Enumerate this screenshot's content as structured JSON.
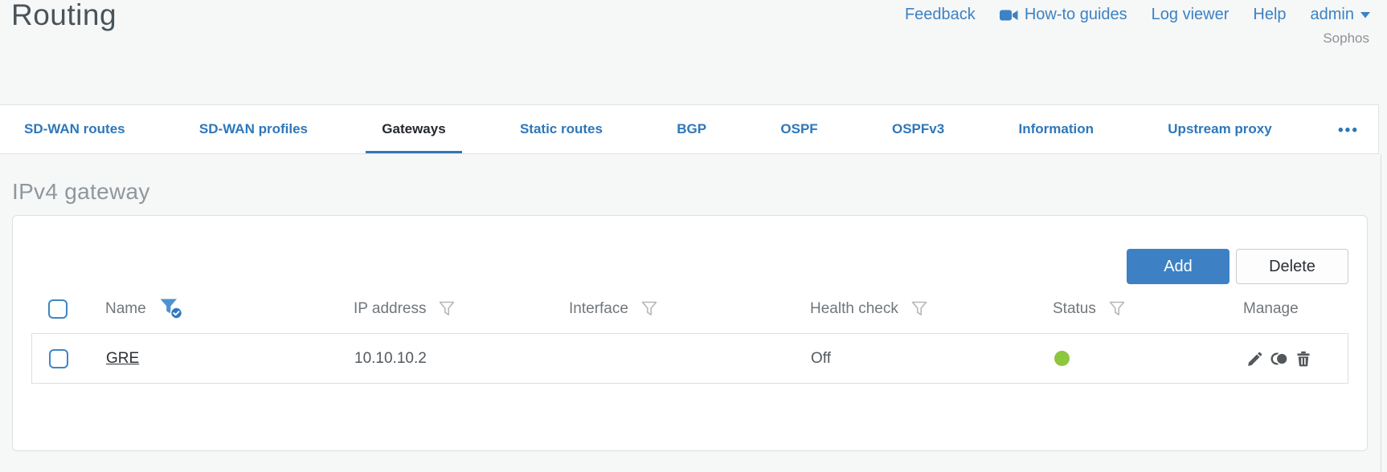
{
  "window": {
    "title": "Routing",
    "brand": "Sophos"
  },
  "header": {
    "links": [
      {
        "label": "Feedback"
      },
      {
        "label": "How-to guides",
        "icon": "video-camera"
      },
      {
        "label": "Log viewer"
      },
      {
        "label": "Help"
      },
      {
        "label": "admin",
        "icon": "chevron-down"
      }
    ]
  },
  "tabs": {
    "items": [
      {
        "label": "SD-WAN routes",
        "active": false
      },
      {
        "label": "SD-WAN profiles",
        "active": false
      },
      {
        "label": "Gateways",
        "active": true
      },
      {
        "label": "Static routes",
        "active": false
      },
      {
        "label": "BGP",
        "active": false
      },
      {
        "label": "OSPF",
        "active": false
      },
      {
        "label": "OSPFv3",
        "active": false
      },
      {
        "label": "Information",
        "active": false
      },
      {
        "label": "Upstream proxy",
        "active": false
      }
    ],
    "more_label": "•••"
  },
  "section": {
    "heading": "IPv4 gateway"
  },
  "toolbar": {
    "add_label": "Add",
    "delete_label": "Delete"
  },
  "table": {
    "columns": [
      {
        "label": "Name",
        "filter": "active"
      },
      {
        "label": "IP address",
        "filter": "default"
      },
      {
        "label": "Interface",
        "filter": "default"
      },
      {
        "label": "Health check",
        "filter": "default"
      },
      {
        "label": "Status",
        "filter": "default"
      },
      {
        "label": "Manage",
        "filter": "none"
      }
    ],
    "rows": [
      {
        "name": "GRE",
        "ip_address": "10.10.10.2",
        "interface": "",
        "health_check": "Off",
        "status": "up",
        "manage_icons": [
          "edit-pencil",
          "clone",
          "delete-trash"
        ]
      }
    ]
  },
  "colors": {
    "link_blue": "#3c82c4",
    "active_tab_underline": "#2e77ba",
    "add_button_blue": "#3d81c4",
    "status_green": "#8dc63f"
  }
}
